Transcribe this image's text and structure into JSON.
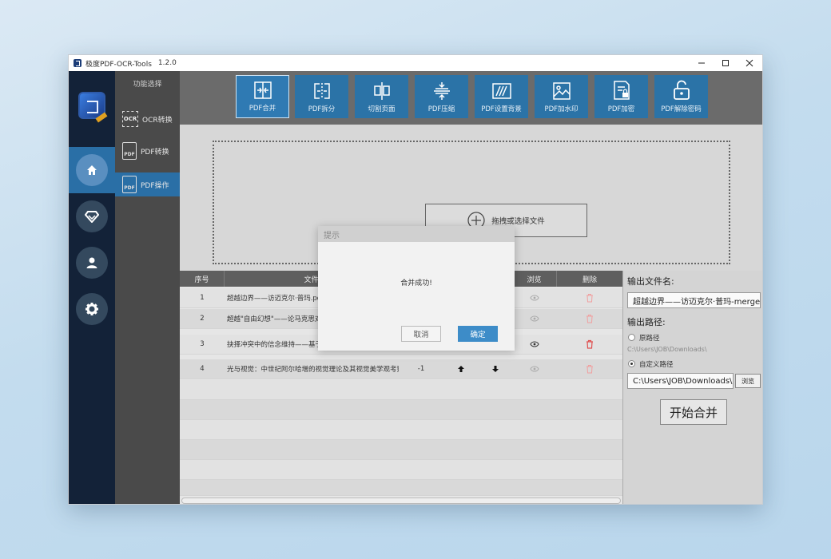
{
  "window": {
    "title": "极度PDF-OCR-Tools",
    "version": "1.2.0"
  },
  "sub_nav": {
    "heading": "功能选择",
    "items": [
      {
        "label": "OCR转换",
        "icon": "ocr-icon"
      },
      {
        "label": "PDF转换",
        "icon": "pdf-convert-icon",
        "icon_text": "PDF"
      },
      {
        "label": "PDF操作",
        "icon": "pdf-operate-icon",
        "icon_text": "PDF"
      }
    ]
  },
  "toolbar": {
    "buttons": [
      {
        "label": "PDF合并"
      },
      {
        "label": "PDF拆分"
      },
      {
        "label": "切割页面"
      },
      {
        "label": "PDF压缩"
      },
      {
        "label": "PDF设置背景"
      },
      {
        "label": "PDF加水印"
      },
      {
        "label": "PDF加密"
      },
      {
        "label": "PDF解除密码"
      }
    ]
  },
  "drop": {
    "choose_label": "拖拽或选择文件"
  },
  "table": {
    "headers": [
      "序号",
      "文件",
      "",
      "",
      "浏览",
      "删除"
    ],
    "rows": [
      {
        "no": "1",
        "name": "超越边界——访迈克尔·普玛.pdf"
      },
      {
        "no": "2",
        "name": "超越\"自由幻想\"——论马克思对"
      },
      {
        "no": "3",
        "name": "抉择冲突中的信念维持——基于"
      },
      {
        "no": "4",
        "name": "光与视觉：中世纪阿尔哈增的视觉理论及其视觉美学观考察.",
        "pages": "-1"
      }
    ]
  },
  "right_panel": {
    "output_name_label": "输出文件名:",
    "output_name_value": "超越边界——访迈克尔·普玛-merge",
    "output_path_label": "输出路径:",
    "option_original": "原路径",
    "original_path_hint": "C:\\Users\\JOB\\Downloads\\",
    "option_custom": "自定义路径",
    "custom_path_value": "C:\\Users\\JOB\\Downloads\\",
    "browse_label": "浏览",
    "start_label": "开始合并"
  },
  "modal": {
    "title": "提示",
    "message": "合并成功!",
    "cancel": "取消",
    "ok": "确定"
  },
  "colors": {
    "accent": "#2b73a7",
    "nav_dark": "#132238",
    "delete": "#e05050"
  }
}
